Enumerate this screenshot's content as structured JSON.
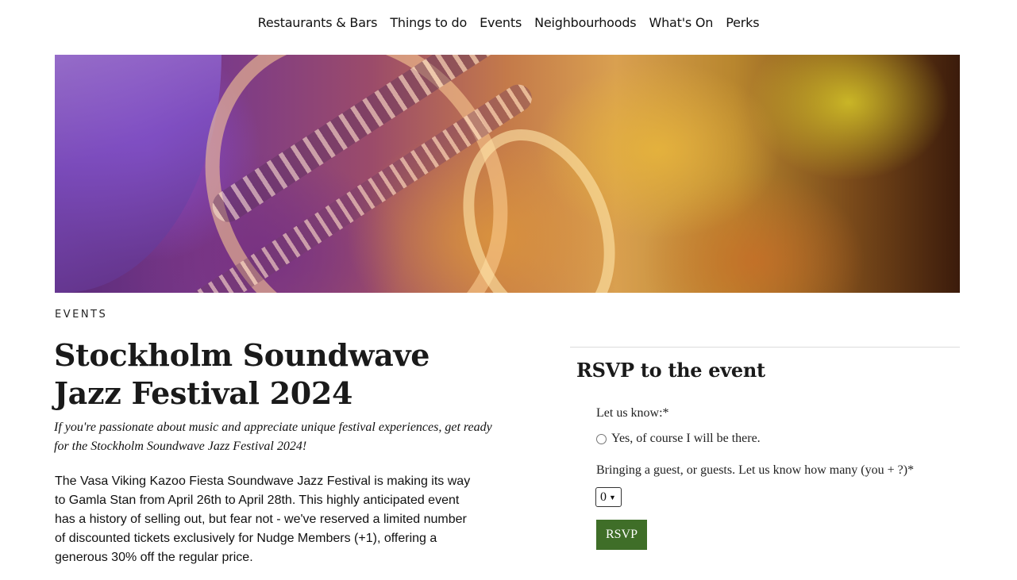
{
  "nav": {
    "items": [
      "Restaurants & Bars",
      "Things to do",
      "Events",
      "Neighbourhoods",
      "What's On",
      "Perks"
    ]
  },
  "hero": {
    "image": "saxophone-player-photo"
  },
  "article": {
    "category": "EVENTS",
    "title": "Stockholm Soundwave Jazz Festival 2024",
    "subtitle": "If you're passionate about music and appreciate unique festival experiences, get ready for the Stockholm Soundwave Jazz Festival 2024!",
    "body": "The Vasa Viking Kazoo Fiesta Soundwave Jazz Festival is making its way to Gamla Stan from April 26th to April 28th. This highly anticipated event has a history of selling out, but fear not - we've reserved a limited number of discounted tickets exclusively for Nudge Members (+1), offering a generous 30% off the regular price."
  },
  "rsvp": {
    "heading": "RSVP to the event",
    "let_us_know_label": "Let us know:*",
    "attend_option": "Yes, of course I will be there.",
    "guests_label": "Bringing a guest, or guests. Let us know how many (you + ?)*",
    "guests_value": "0",
    "submit_label": "RSVP",
    "accent_color": "#3f6e28"
  }
}
